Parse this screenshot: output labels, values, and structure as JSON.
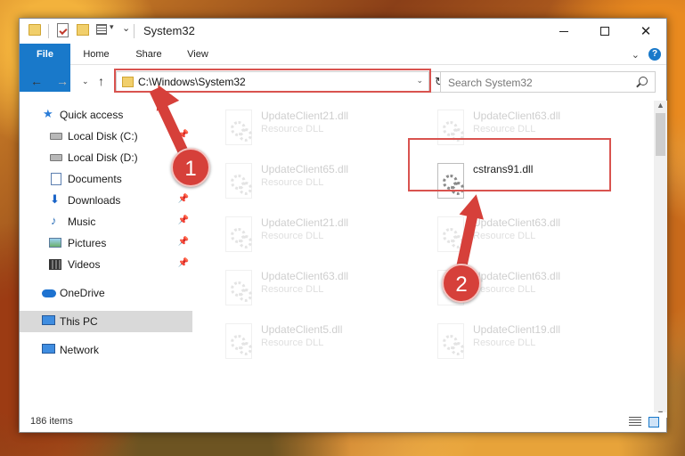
{
  "window": {
    "title": "System32",
    "controls": {
      "minimize": "",
      "maximize": "",
      "close": "✕"
    }
  },
  "ribbon": {
    "tabs": [
      "File",
      "Home",
      "Share",
      "View"
    ],
    "expand": "⌄",
    "help": "?"
  },
  "nav": {
    "back": "←",
    "forward": "→",
    "recent": "⌄",
    "up": "↑",
    "address": "C:\\Windows\\System32",
    "address_dropdown": "⌄",
    "refresh": "↻",
    "search_placeholder": "Search System32"
  },
  "sidebar": {
    "items": [
      {
        "label": "Quick access",
        "icon": "star-icon",
        "pinned": false,
        "selected": false
      },
      {
        "label": "Local Disk (C:)",
        "icon": "disk-icon",
        "pinned": true,
        "selected": false
      },
      {
        "label": "Local Disk (D:)",
        "icon": "disk-icon",
        "pinned": false,
        "selected": false
      },
      {
        "label": "Documents",
        "icon": "documents-icon",
        "pinned": true,
        "selected": false
      },
      {
        "label": "Downloads",
        "icon": "downloads-icon",
        "pinned": true,
        "selected": false
      },
      {
        "label": "Music",
        "icon": "music-icon",
        "pinned": true,
        "selected": false
      },
      {
        "label": "Pictures",
        "icon": "pictures-icon",
        "pinned": true,
        "selected": false
      },
      {
        "label": "Videos",
        "icon": "videos-icon",
        "pinned": true,
        "selected": false
      },
      {
        "label": "OneDrive",
        "icon": "onedrive-icon",
        "pinned": false,
        "selected": false
      },
      {
        "label": "This PC",
        "icon": "this-pc-icon",
        "pinned": false,
        "selected": true
      },
      {
        "label": "Network",
        "icon": "network-icon",
        "pinned": false,
        "selected": false
      }
    ],
    "pin_glyph": "📌"
  },
  "files": [
    {
      "name": "UpdateClient21.dll",
      "type": "Resource DLL",
      "faded": true
    },
    {
      "name": "UpdateClient63.dll",
      "type": "Resource DLL",
      "faded": true
    },
    {
      "name": "UpdateClient65.dll",
      "type": "Resource DLL",
      "faded": true
    },
    {
      "name": "cstrans91.dll",
      "type": "",
      "faded": false
    },
    {
      "name": "UpdateClient21.dll",
      "type": "Resource DLL",
      "faded": true
    },
    {
      "name": "UpdateClient63.dll",
      "type": "Resource DLL",
      "faded": true
    },
    {
      "name": "UpdateClient63.dll",
      "type": "Resource DLL",
      "faded": true
    },
    {
      "name": "UpdateClient63.dll",
      "type": "Resource DLL",
      "faded": true
    },
    {
      "name": "UpdateClient5.dll",
      "type": "Resource DLL",
      "faded": true
    },
    {
      "name": "UpdateClient19.dll",
      "type": "Resource DLL",
      "faded": true
    }
  ],
  "status": {
    "count": "186 items"
  },
  "annotations": {
    "callout1": "1",
    "callout2": "2",
    "highlight_color": "#d9534f"
  },
  "colors": {
    "accent": "#1979ca",
    "annotation": "#d6403a"
  }
}
